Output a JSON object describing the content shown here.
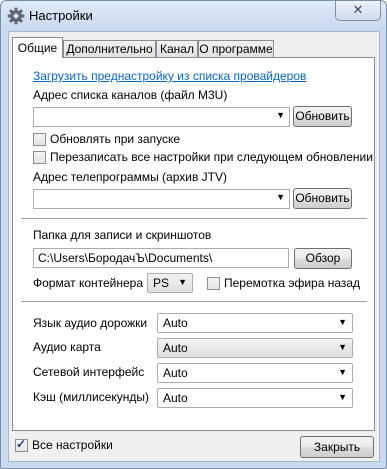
{
  "window": {
    "title": "Настройки",
    "close_glyph": "✕",
    "title_icon": "gear-icon"
  },
  "tabs": [
    {
      "label": "Общие",
      "active": true
    },
    {
      "label": "Дополнительно",
      "active": false
    },
    {
      "label": "Канал",
      "active": false
    },
    {
      "label": "О программе",
      "active": false
    }
  ],
  "general": {
    "preset_link": "Загрузить преднастройку из списка провайдеров",
    "channels_label": "Адрес списка каналов (файл M3U)",
    "channels_value": "",
    "channels_refresh": "Обновить",
    "update_on_start": {
      "label": "Обновлять при запуске",
      "checked": false
    },
    "overwrite_settings": {
      "label": "Перезаписать все настройки при следующем обновлении",
      "checked": false
    },
    "epg_label": "Адрес телепрограммы (архив JTV)",
    "epg_value": "",
    "epg_refresh": "Обновить",
    "record_folder_label": "Папка для записи и скриншотов",
    "record_folder_value": "C:\\Users\\БородачЪ\\Documents\\",
    "browse_button": "Обзор",
    "container_label": "Формат контейнера",
    "container_value": "PS",
    "rewind": {
      "label": "Перемотка эфира назад",
      "checked": false
    },
    "audio_track_label": "Язык аудио дорожки",
    "audio_track_value": "Auto",
    "audio_card_label": "Аудио карта",
    "audio_card_value": "Auto",
    "network_label": "Сетевой интерфейс",
    "network_value": "Auto",
    "cache_label": "Кэш (миллисекунды)",
    "cache_value": "Auto"
  },
  "footer": {
    "all_settings": {
      "label": "Все настройки",
      "checked": true
    },
    "close_button": "Закрыть"
  },
  "dropdown_glyph": "▼"
}
